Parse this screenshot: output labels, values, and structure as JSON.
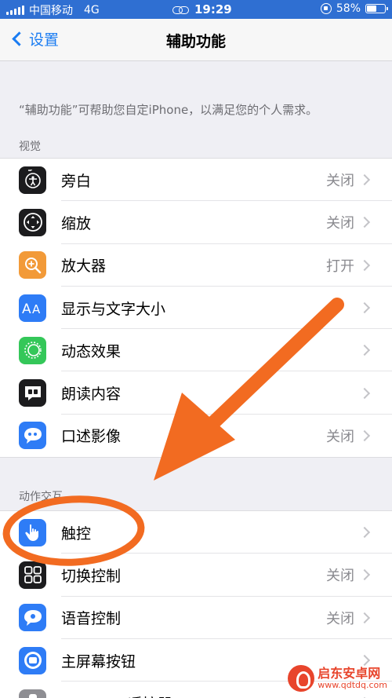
{
  "status_bar": {
    "carrier": "中国移动",
    "network": "4G",
    "time": "19:29",
    "battery_percent": "58%",
    "battery_level": 0.58
  },
  "nav": {
    "back_label": "设置",
    "title": "辅助功能"
  },
  "description": "“辅助功能”可帮助您自定iPhone，以满足您的个人需求。",
  "sections": {
    "vision": {
      "header": "视觉",
      "items": [
        {
          "label": "旁白",
          "value": "关闭",
          "icon": "voiceover-icon",
          "color": "#1c1c1e"
        },
        {
          "label": "缩放",
          "value": "关闭",
          "icon": "zoom-icon",
          "color": "#1c1c1e"
        },
        {
          "label": "放大器",
          "value": "打开",
          "icon": "magnifier-icon",
          "color": "#f29a38"
        },
        {
          "label": "显示与文字大小",
          "value": "",
          "icon": "text-size-icon",
          "color": "#2e7cf6"
        },
        {
          "label": "动态效果",
          "value": "",
          "icon": "motion-icon",
          "color": "#34c759"
        },
        {
          "label": "朗读内容",
          "value": "",
          "icon": "spoken-content-icon",
          "color": "#1c1c1e"
        },
        {
          "label": "口述影像",
          "value": "关闭",
          "icon": "audio-description-icon",
          "color": "#2e7cf6"
        }
      ]
    },
    "physical": {
      "header": "动作交互",
      "items": [
        {
          "label": "触控",
          "value": "",
          "icon": "touch-icon",
          "color": "#2e7cf6"
        },
        {
          "label": "切换控制",
          "value": "关闭",
          "icon": "switch-control-icon",
          "color": "#1c1c1e"
        },
        {
          "label": "语音控制",
          "value": "关闭",
          "icon": "voice-control-icon",
          "color": "#2e7cf6"
        },
        {
          "label": "主屏幕按钮",
          "value": "",
          "icon": "home-button-icon",
          "color": "#2e7cf6"
        },
        {
          "label": "Apple TV遥控器",
          "value": "",
          "icon": "apple-tv-remote-icon",
          "color": "#8e8e93"
        }
      ]
    }
  },
  "annotation_color": "#f26b21",
  "watermark": {
    "name": "启东安卓网",
    "url": "www.qdtdq.com"
  }
}
